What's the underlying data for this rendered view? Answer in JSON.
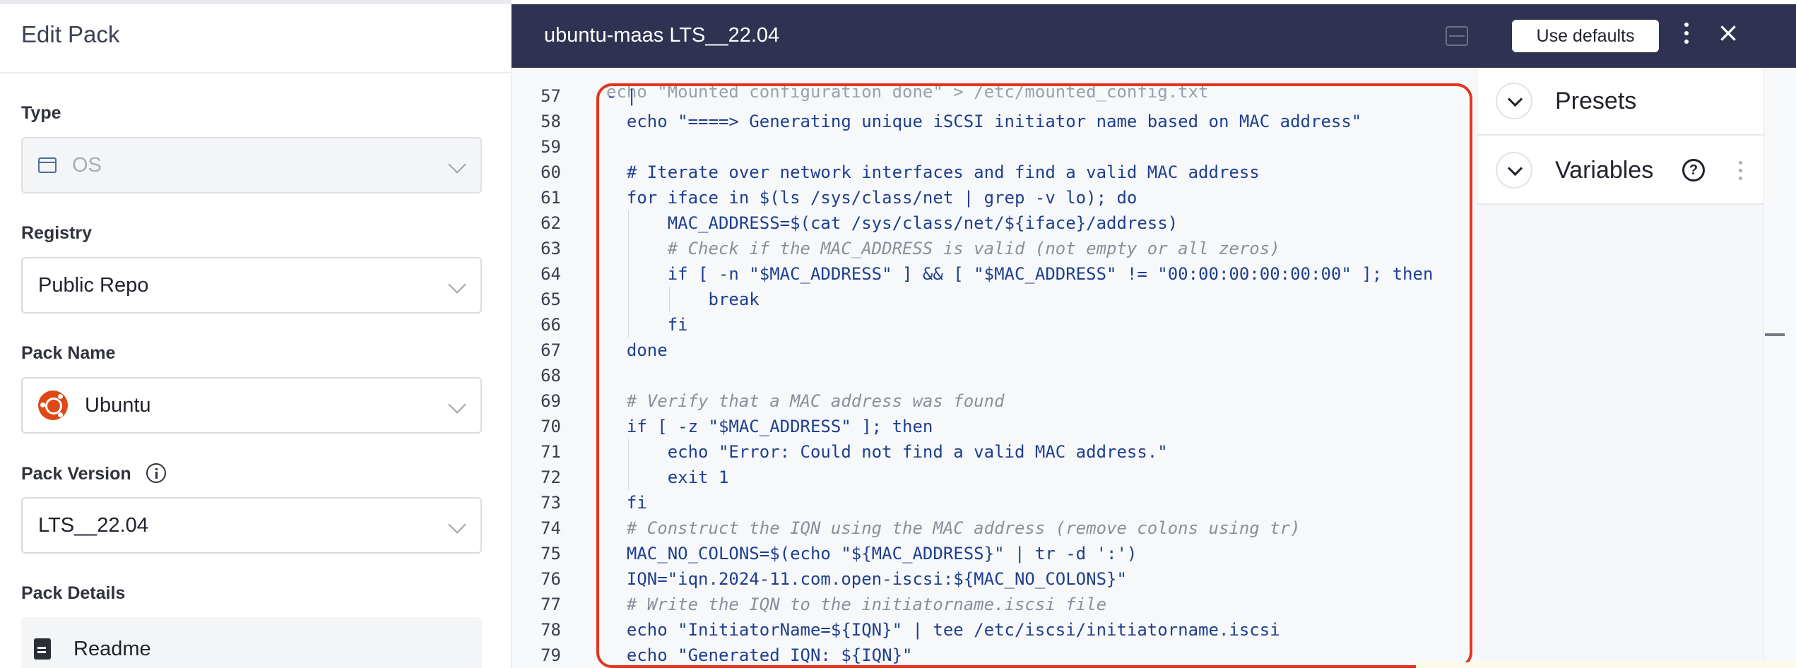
{
  "left_panel": {
    "title": "Edit Pack",
    "type": {
      "label": "Type",
      "value": "OS",
      "icon": "window-icon"
    },
    "registry": {
      "label": "Registry",
      "value": "Public Repo"
    },
    "pack_name": {
      "label": "Pack Name",
      "value": "Ubuntu",
      "icon": "ubuntu-logo"
    },
    "pack_version": {
      "label": "Pack Version",
      "value": "LTS__22.04",
      "icon": "info-icon"
    },
    "pack_details": {
      "label": "Pack Details",
      "readme": "Readme",
      "icon": "document-icon"
    }
  },
  "editor": {
    "title": "ubuntu-maas LTS__22.04",
    "use_defaults_label": "Use defaults",
    "close_glyph": "×",
    "partial_top_line": "echo \"Mounted configuration done\" > /etc/mounted_config.txt",
    "lines": [
      {
        "n": "57",
        "text": "- |",
        "kind": "code"
      },
      {
        "n": "58",
        "text": "  echo \"====> Generating unique iSCSI initiator name based on MAC address\"",
        "kind": "code"
      },
      {
        "n": "59",
        "text": "",
        "kind": "code"
      },
      {
        "n": "60",
        "text": "  # Iterate over network interfaces and find a valid MAC address",
        "kind": "code"
      },
      {
        "n": "61",
        "text": "  for iface in $(ls /sys/class/net | grep -v lo); do",
        "kind": "code"
      },
      {
        "n": "62",
        "text": "      MAC_ADDRESS=$(cat /sys/class/net/${iface}/address)",
        "kind": "code"
      },
      {
        "n": "63",
        "text": "      # Check if the MAC_ADDRESS is valid (not empty or all zeros)",
        "kind": "comment"
      },
      {
        "n": "64",
        "text": "      if [ -n \"$MAC_ADDRESS\" ] && [ \"$MAC_ADDRESS\" != \"00:00:00:00:00:00\" ]; then",
        "kind": "code"
      },
      {
        "n": "65",
        "text": "          break",
        "kind": "code"
      },
      {
        "n": "66",
        "text": "      fi",
        "kind": "code"
      },
      {
        "n": "67",
        "text": "  done",
        "kind": "code"
      },
      {
        "n": "68",
        "text": "",
        "kind": "code"
      },
      {
        "n": "69",
        "text": "  # Verify that a MAC address was found",
        "kind": "comment"
      },
      {
        "n": "70",
        "text": "  if [ -z \"$MAC_ADDRESS\" ]; then",
        "kind": "code"
      },
      {
        "n": "71",
        "text": "      echo \"Error: Could not find a valid MAC address.\"",
        "kind": "code"
      },
      {
        "n": "72",
        "text": "      exit 1",
        "kind": "code"
      },
      {
        "n": "73",
        "text": "  fi",
        "kind": "code"
      },
      {
        "n": "74",
        "text": "  # Construct the IQN using the MAC address (remove colons using tr)",
        "kind": "comment"
      },
      {
        "n": "75",
        "text": "  MAC_NO_COLONS=$(echo \"${MAC_ADDRESS}\" | tr -d ':')",
        "kind": "code"
      },
      {
        "n": "76",
        "text": "  IQN=\"iqn.2024-11.com.open-iscsi:${MAC_NO_COLONS}\"",
        "kind": "code"
      },
      {
        "n": "77",
        "text": "  # Write the IQN to the initiatorname.iscsi file",
        "kind": "comment"
      },
      {
        "n": "78",
        "text": "  echo \"InitiatorName=${IQN}\" | tee /etc/iscsi/initiatorname.iscsi",
        "kind": "code"
      },
      {
        "n": "79",
        "text": "  echo \"Generated IQN: ${IQN}\"",
        "kind": "code"
      }
    ]
  },
  "side_panel": {
    "presets_label": "Presets",
    "variables_label": "Variables",
    "help_glyph": "?"
  },
  "colors": {
    "header_bg": "#2f3351",
    "code_text": "#1e3f8f",
    "comment_text": "#8a8f9a",
    "highlight_border": "#e2361f",
    "ubuntu_orange": "#dd4814"
  }
}
